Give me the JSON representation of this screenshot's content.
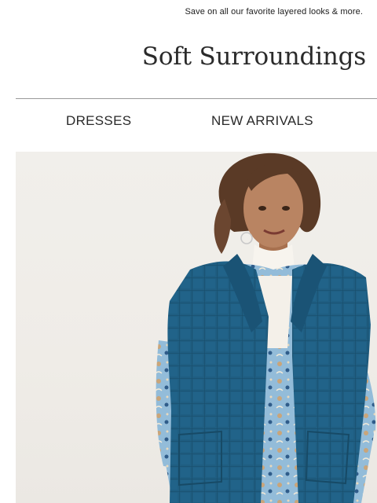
{
  "preheader": {
    "text": "Save on all our favorite layered looks & more."
  },
  "brand": {
    "logo_text": "Soft Surroundings"
  },
  "nav": {
    "items": [
      {
        "label": "DRESSES"
      },
      {
        "label": "NEW ARRIVALS"
      }
    ]
  },
  "hero": {
    "image_desc": "model-wearing-quilted-vest",
    "colors": {
      "background": "#efece7",
      "vest": "#1f5e82",
      "shirt": "#8fb8d6",
      "turtleneck": "#f7f4ee",
      "hair": "#5a3a26",
      "skin": "#b98462"
    }
  }
}
